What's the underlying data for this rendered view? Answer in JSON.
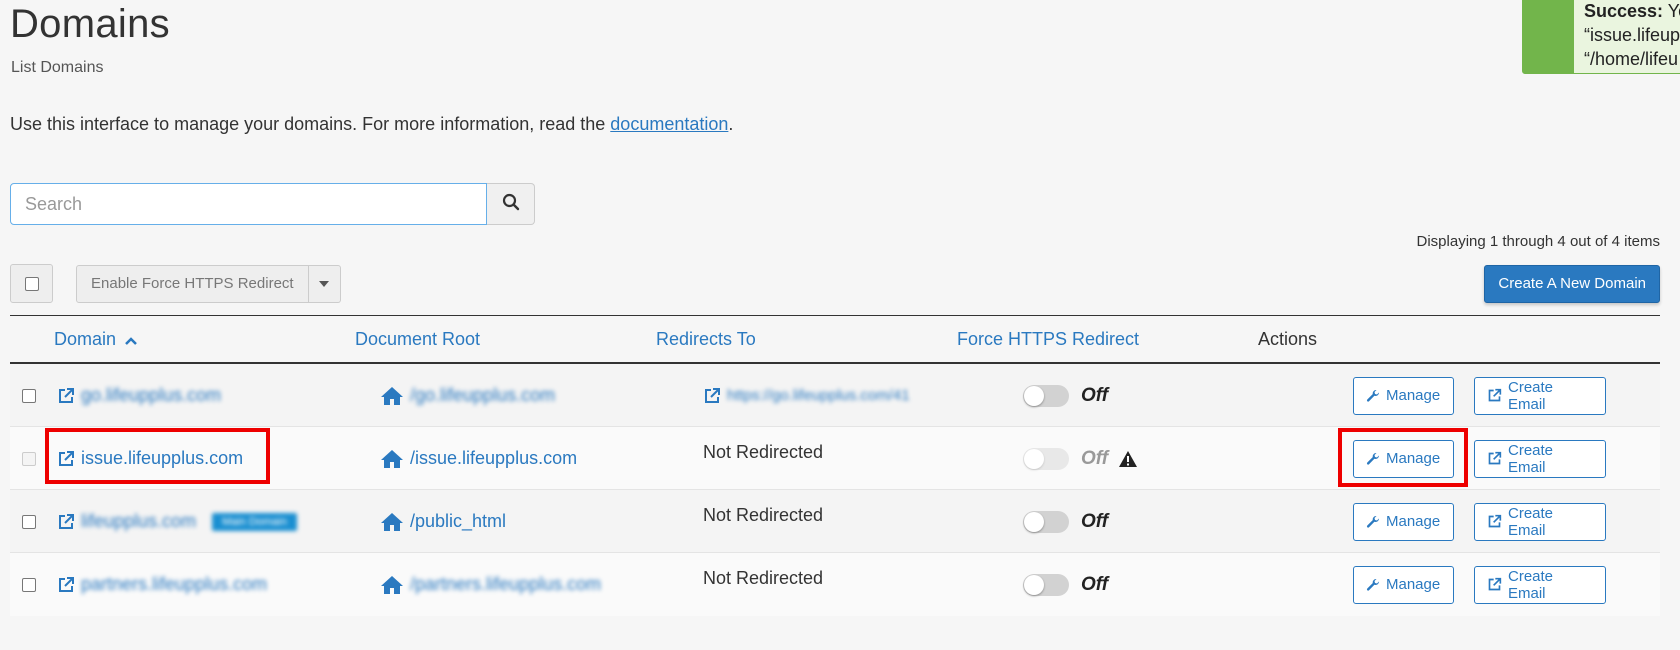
{
  "page": {
    "title": "Domains",
    "subtitle": "List Domains",
    "intro_text": "Use this interface to manage your domains. For more information, read the ",
    "intro_link": "documentation",
    "intro_end": "."
  },
  "search": {
    "placeholder": "Search",
    "button_icon": "search-icon"
  },
  "pagination": {
    "summary": "Displaying 1 through 4 out of 4 items"
  },
  "toolbar": {
    "bulk_action_label": "Enable Force HTTPS Redirect",
    "create_domain_label": "Create A New Domain"
  },
  "table": {
    "headers": {
      "domain": "Domain",
      "document_root": "Document Root",
      "redirects_to": "Redirects To",
      "force_https": "Force HTTPS Redirect",
      "actions": "Actions"
    },
    "rows": [
      {
        "domain": "go.lifeupplus.com",
        "document_root": "/go.lifeupplus.com",
        "redirects_to": "https://go.lifeupplus.com/41",
        "https_state": "Off",
        "manage_label": "Manage",
        "email_label": "Create Email"
      },
      {
        "domain": "issue.lifeupplus.com",
        "document_root": "/issue.lifeupplus.com",
        "redirects_to": "Not Redirected",
        "https_state": "Off",
        "manage_label": "Manage",
        "email_label": "Create Email"
      },
      {
        "domain": "lifeupplus.com",
        "badge": "Main Domain",
        "document_root": "/public_html",
        "redirects_to": "Not Redirected",
        "https_state": "Off",
        "manage_label": "Manage",
        "email_label": "Create Email"
      },
      {
        "domain": "partners.lifeupplus.com",
        "document_root": "/partners.lifeupplus.com",
        "redirects_to": "Not Redirected",
        "https_state": "Off",
        "manage_label": "Manage",
        "email_label": "Create Email"
      }
    ]
  },
  "toast": {
    "title": "Success:",
    "line1_rest": "Yo",
    "line2": "“issue.lifeup",
    "line3": "“/home/lifeu"
  },
  "colors": {
    "accent": "#2a79c0",
    "success": "#72b54b",
    "highlight": "#e00000"
  }
}
